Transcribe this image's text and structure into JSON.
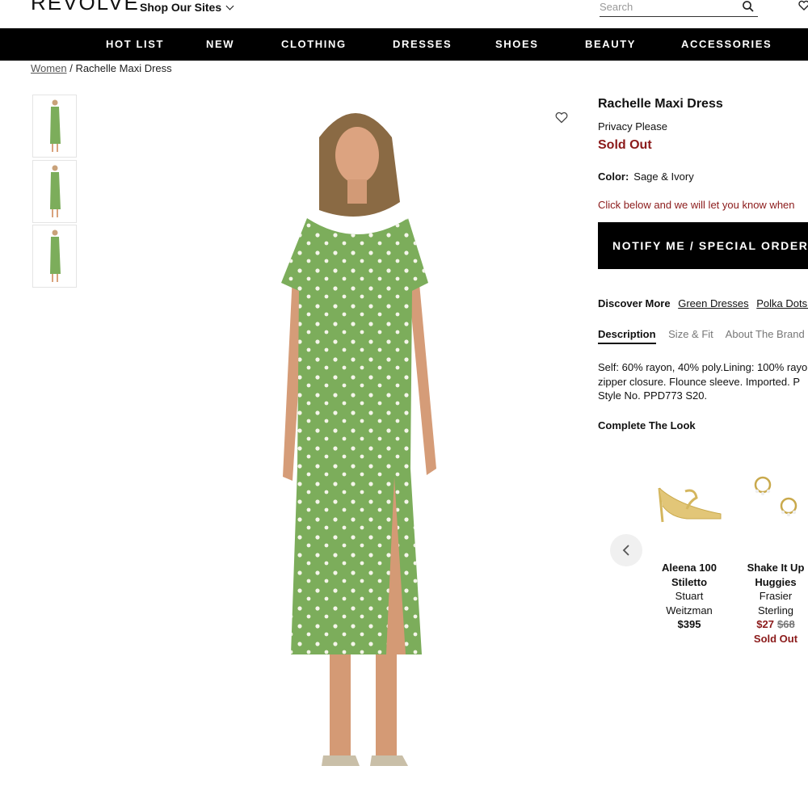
{
  "header": {
    "logo": "REVOLVE",
    "sites_label": "Shop Our Sites",
    "search_placeholder": "Search"
  },
  "nav": [
    "HOT LIST",
    "NEW",
    "CLOTHING",
    "DRESSES",
    "SHOES",
    "BEAUTY",
    "ACCESSORIES"
  ],
  "breadcrumb": {
    "parent": "Women",
    "separator": "/",
    "current": "Rachelle Maxi Dress"
  },
  "product": {
    "title": "Rachelle Maxi Dress",
    "brand": "Privacy Please",
    "status": "Sold Out",
    "color_label": "Color:",
    "color_value": "Sage & Ivory",
    "notify_message": "Click below and we will let you know when",
    "notify_button": "NOTIFY ME / SPECIAL ORDER",
    "discover_label": "Discover More",
    "discover_links": [
      "Green Dresses",
      "Polka Dots D"
    ],
    "tabs": [
      "Description",
      "Size & Fit",
      "About The Brand"
    ],
    "description_lines": [
      "Self: 60% rayon, 40% poly.Lining: 100% rayo",
      "zipper closure. Flounce sleeve. Imported. P",
      "Style No. PPD773 S20."
    ],
    "dress_color": "#7cad5b"
  },
  "complete_the_look": {
    "title": "Complete The Look",
    "items": [
      {
        "name_line1": "Aleena 100",
        "name_line2": "Stiletto",
        "brand_line1": "Stuart",
        "brand_line2": "Weitzman",
        "price": "$395"
      },
      {
        "name_line1": "Shake It Up",
        "name_line2": "Huggies",
        "brand_line1": "Frasier",
        "brand_line2": "Sterling",
        "sale_price": "$27",
        "original_price": "$68",
        "status": "Sold Out"
      }
    ]
  },
  "colors": {
    "nav_bg": "#000000",
    "sold_out": "#8b1a1a"
  }
}
